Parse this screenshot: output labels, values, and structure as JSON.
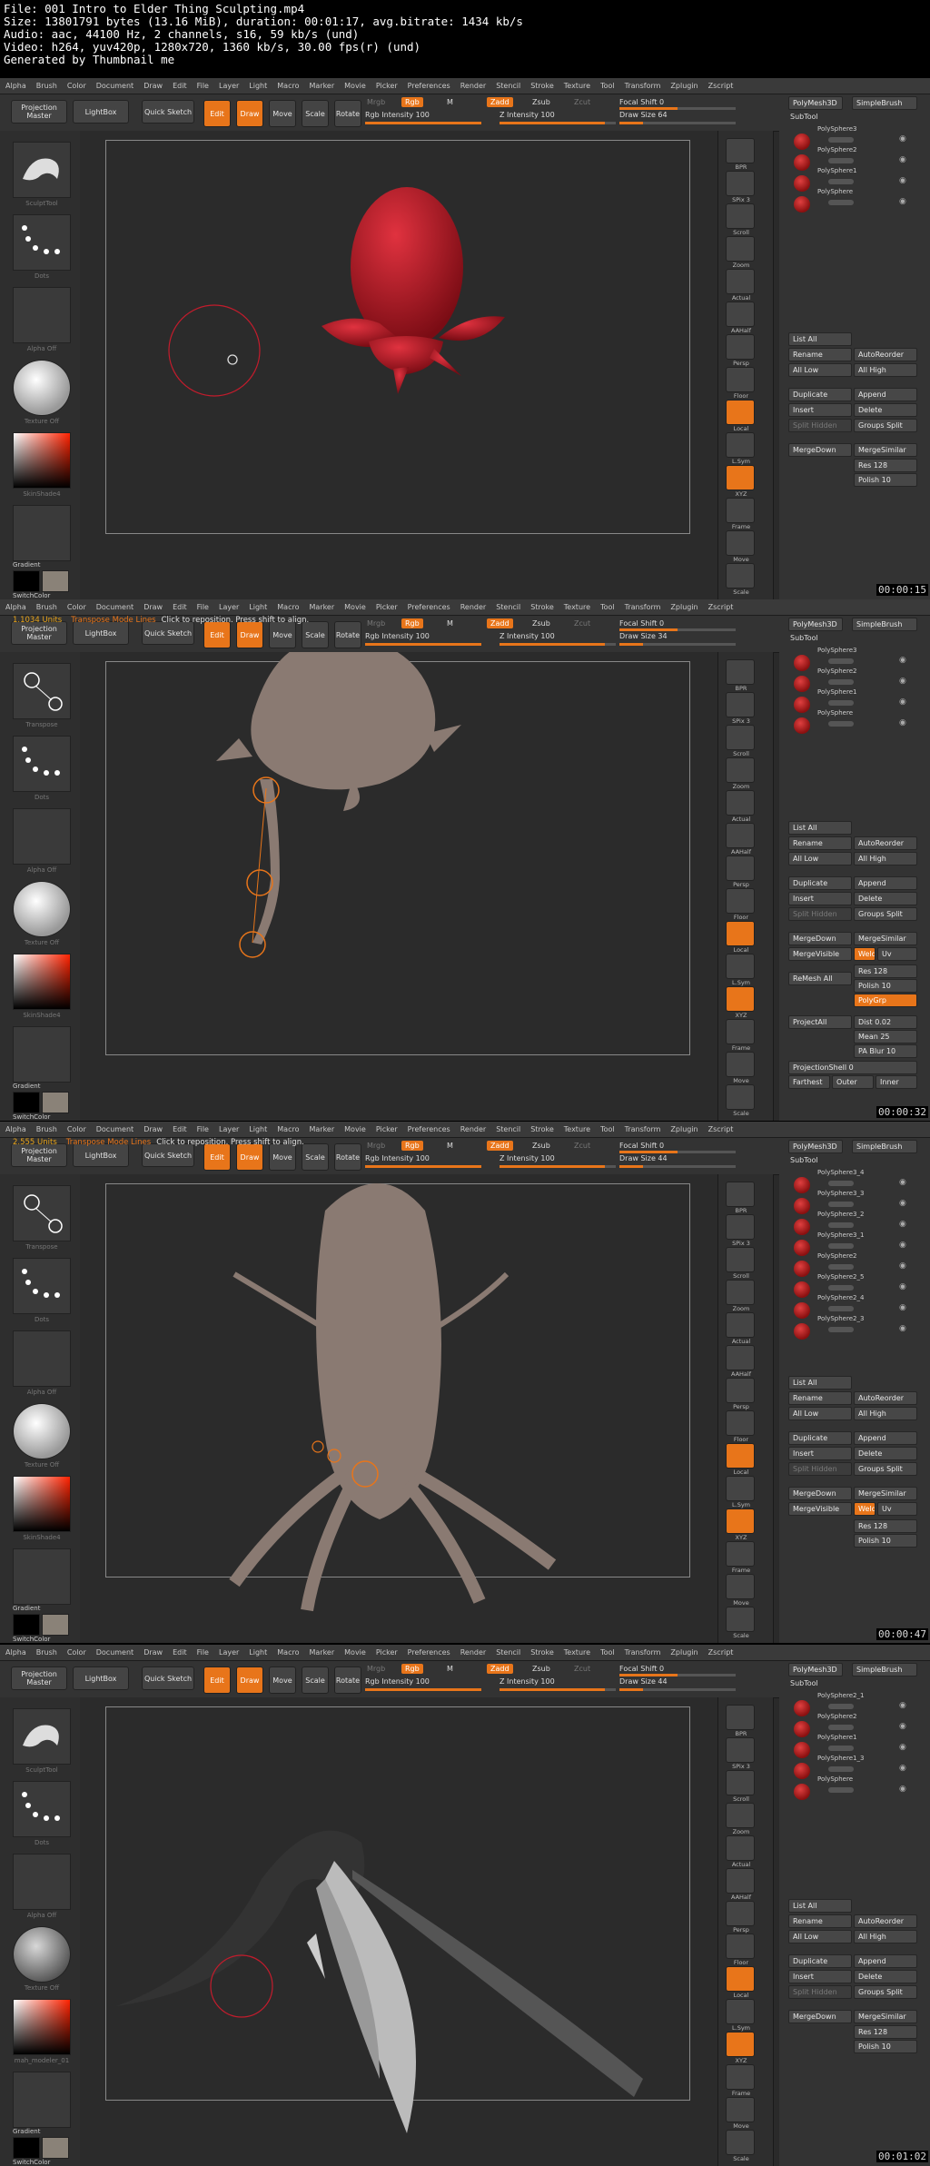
{
  "header": {
    "lines": [
      "File: 001 Intro to Elder Thing Sculpting.mp4",
      "Size: 13801791 bytes (13.16 MiB), duration: 00:01:17, avg.bitrate: 1434 kb/s",
      "Audio: aac, 44100 Hz, 2 channels, s16, 59 kb/s (und)",
      "Video: h264, yuv420p, 1280x720, 1360 kb/s, 30.00 fps(r) (und)",
      "Generated by Thumbnail me"
    ]
  },
  "menu": [
    "Alpha",
    "Brush",
    "Color",
    "Document",
    "Draw",
    "Edit",
    "File",
    "Layer",
    "Light",
    "Macro",
    "Marker",
    "Movie",
    "Picker",
    "Preferences",
    "Render",
    "Stencil",
    "Stroke",
    "Texture",
    "Tool",
    "Transform",
    "Zplugin",
    "Zscript"
  ],
  "toolbar": {
    "projection_master": "Projection Master",
    "lightbox": "LightBox",
    "quick_sketch": "Quick Sketch",
    "edit": "Edit",
    "draw": "Draw",
    "move": "Move",
    "scale": "Scale",
    "rotate": "Rotate",
    "mrgb": "Mrgb",
    "rgb": "Rgb",
    "m": "M",
    "zadd": "Zadd",
    "zsub": "Zsub",
    "zcut": "Zcut",
    "rgb_intensity": "Rgb Intensity 100",
    "z_intensity": "Z Intensity 100",
    "focal_shift": "Focal Shift 0",
    "draw_size_1": "Draw Size 64",
    "draw_size_2": "Draw Size 34",
    "draw_size_3": "Draw Size 44",
    "draw_size_4": "Draw Size 44"
  },
  "status": {
    "units_2": "1.1034 Units",
    "units_3": "2.555 Units",
    "mode": "Transpose Mode Lines",
    "hint": "Click to reposition. Press shift to align."
  },
  "leftshelf": {
    "dots": "Dots",
    "alpha_off": "Alpha Off",
    "texture_off": "Texture Off",
    "skinshade": "SkinShade4",
    "gradient": "Gradient",
    "switch_color": "SwitchColor",
    "transpose": "Transpose",
    "sculpt": "SculptTool",
    "matcap": "mah_modeler_01"
  },
  "rightshelf": {
    "bpr": "BPR",
    "spix": "SPix 3",
    "scroll": "Scroll",
    "zoom": "Zoom",
    "actual": "Actual",
    "aahalf": "AAHalf",
    "persp": "Persp",
    "floor": "Floor",
    "local": "Local",
    "lsym": "L.Sym",
    "xyz": "XYZ",
    "frame": "Frame",
    "move": "Move",
    "scale": "Scale"
  },
  "panel": {
    "subtool": "SubTool",
    "polymesh": "PolyMesh3D",
    "simplebrush": "SimpleBrush",
    "list_all": "List All",
    "rename": "Rename",
    "autoreorder": "AutoReorder",
    "all_low": "All Low",
    "all_high": "All High",
    "duplicate": "Duplicate",
    "append": "Append",
    "insert": "Insert",
    "delete": "Delete",
    "split_hidden": "Split Hidden",
    "groups_split": "Groups Split",
    "merge_down": "MergeDown",
    "merge_similar": "MergeSimilar",
    "merge_visible": "MergeVisible",
    "weld": "Weld",
    "uv": "Uv",
    "res": "Res 128",
    "polish": "Polish 10",
    "remesh_all": "ReMesh All",
    "polygrp": "PolyGrp",
    "project_all": "ProjectAll",
    "dist": "Dist 0.02",
    "mean": "Mean 25",
    "pa_blur": "PA Blur 10",
    "projection_shell": "ProjectionShell 0",
    "farthest": "Farthest",
    "outer": "Outer",
    "inner": "Inner",
    "f1_items": [
      "PolySphere3",
      "PolySphere2",
      "PolySphere1",
      "PolySphere"
    ],
    "f2_items": [
      "PolySphere3",
      "PolySphere2",
      "PolySphere1",
      "PolySphere"
    ],
    "f3_items": [
      "PolySphere3_4",
      "PolySphere3_3",
      "PolySphere3_2",
      "PolySphere3_1",
      "PolySphere2",
      "PolySphere2_5",
      "PolySphere2_4",
      "PolySphere2_3"
    ],
    "f4_items": [
      "PolySphere2_1",
      "PolySphere2",
      "PolySphere1",
      "PolySphere1_3",
      "PolySphere"
    ]
  },
  "timestamps": [
    "00:00:15",
    "00:00:32",
    "00:00:47",
    "00:01:02"
  ],
  "colors": {
    "accent": "#e8751a",
    "body_red": "#c21c2c",
    "clay": "#8a7a72"
  }
}
